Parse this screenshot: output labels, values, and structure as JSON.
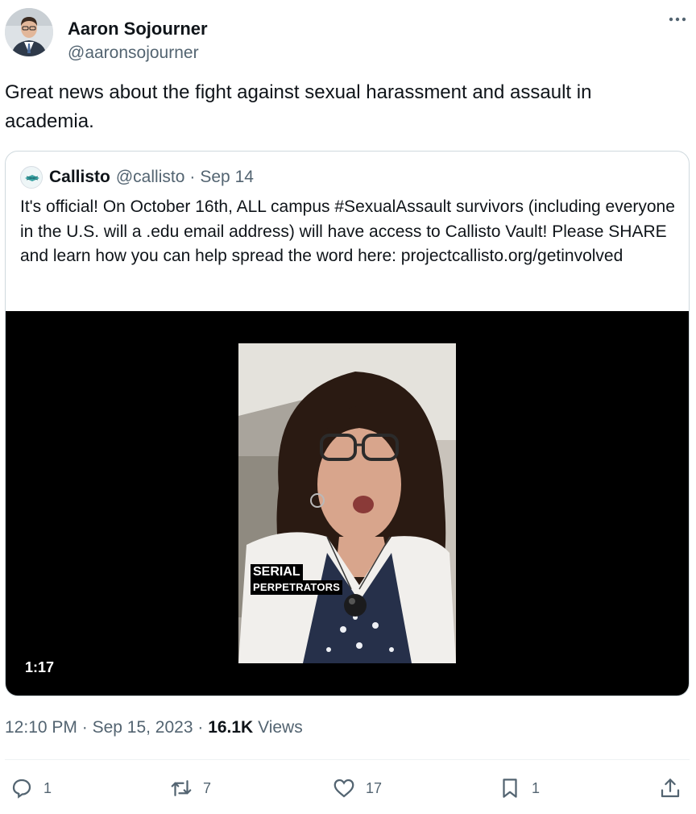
{
  "author": {
    "name": "Aaron Sojourner",
    "handle": "@aaronsojourner"
  },
  "tweet": {
    "text": "Great news about the fight against sexual harassment and assault in academia."
  },
  "quoted": {
    "name": "Callisto",
    "handle": "@callisto",
    "date": "Sep 14",
    "text": "It's official! On October 16th, ALL campus #SexualAssault survivors (including everyone in the U.S. will a .edu email address) will have access to Callisto Vault! Please SHARE and learn how you can help spread the word here: projectcallisto.org/getinvolved",
    "video": {
      "caption_line1": "SERIAL",
      "caption_line2": "PERPETRATORS",
      "duration": "1:17"
    }
  },
  "meta": {
    "time": "12:10 PM",
    "date": "Sep 15, 2023",
    "views_count": "16.1K",
    "views_label": "Views"
  },
  "actions": {
    "replies": "1",
    "reposts": "7",
    "likes": "17",
    "bookmarks": "1"
  },
  "colors": {
    "text_primary": "#0f1419",
    "text_secondary": "#536471",
    "border": "#cfd9de",
    "divider": "#eff3f4"
  },
  "icons": [
    "more-icon",
    "reply-icon",
    "repost-icon",
    "like-icon",
    "bookmark-icon",
    "share-icon"
  ]
}
